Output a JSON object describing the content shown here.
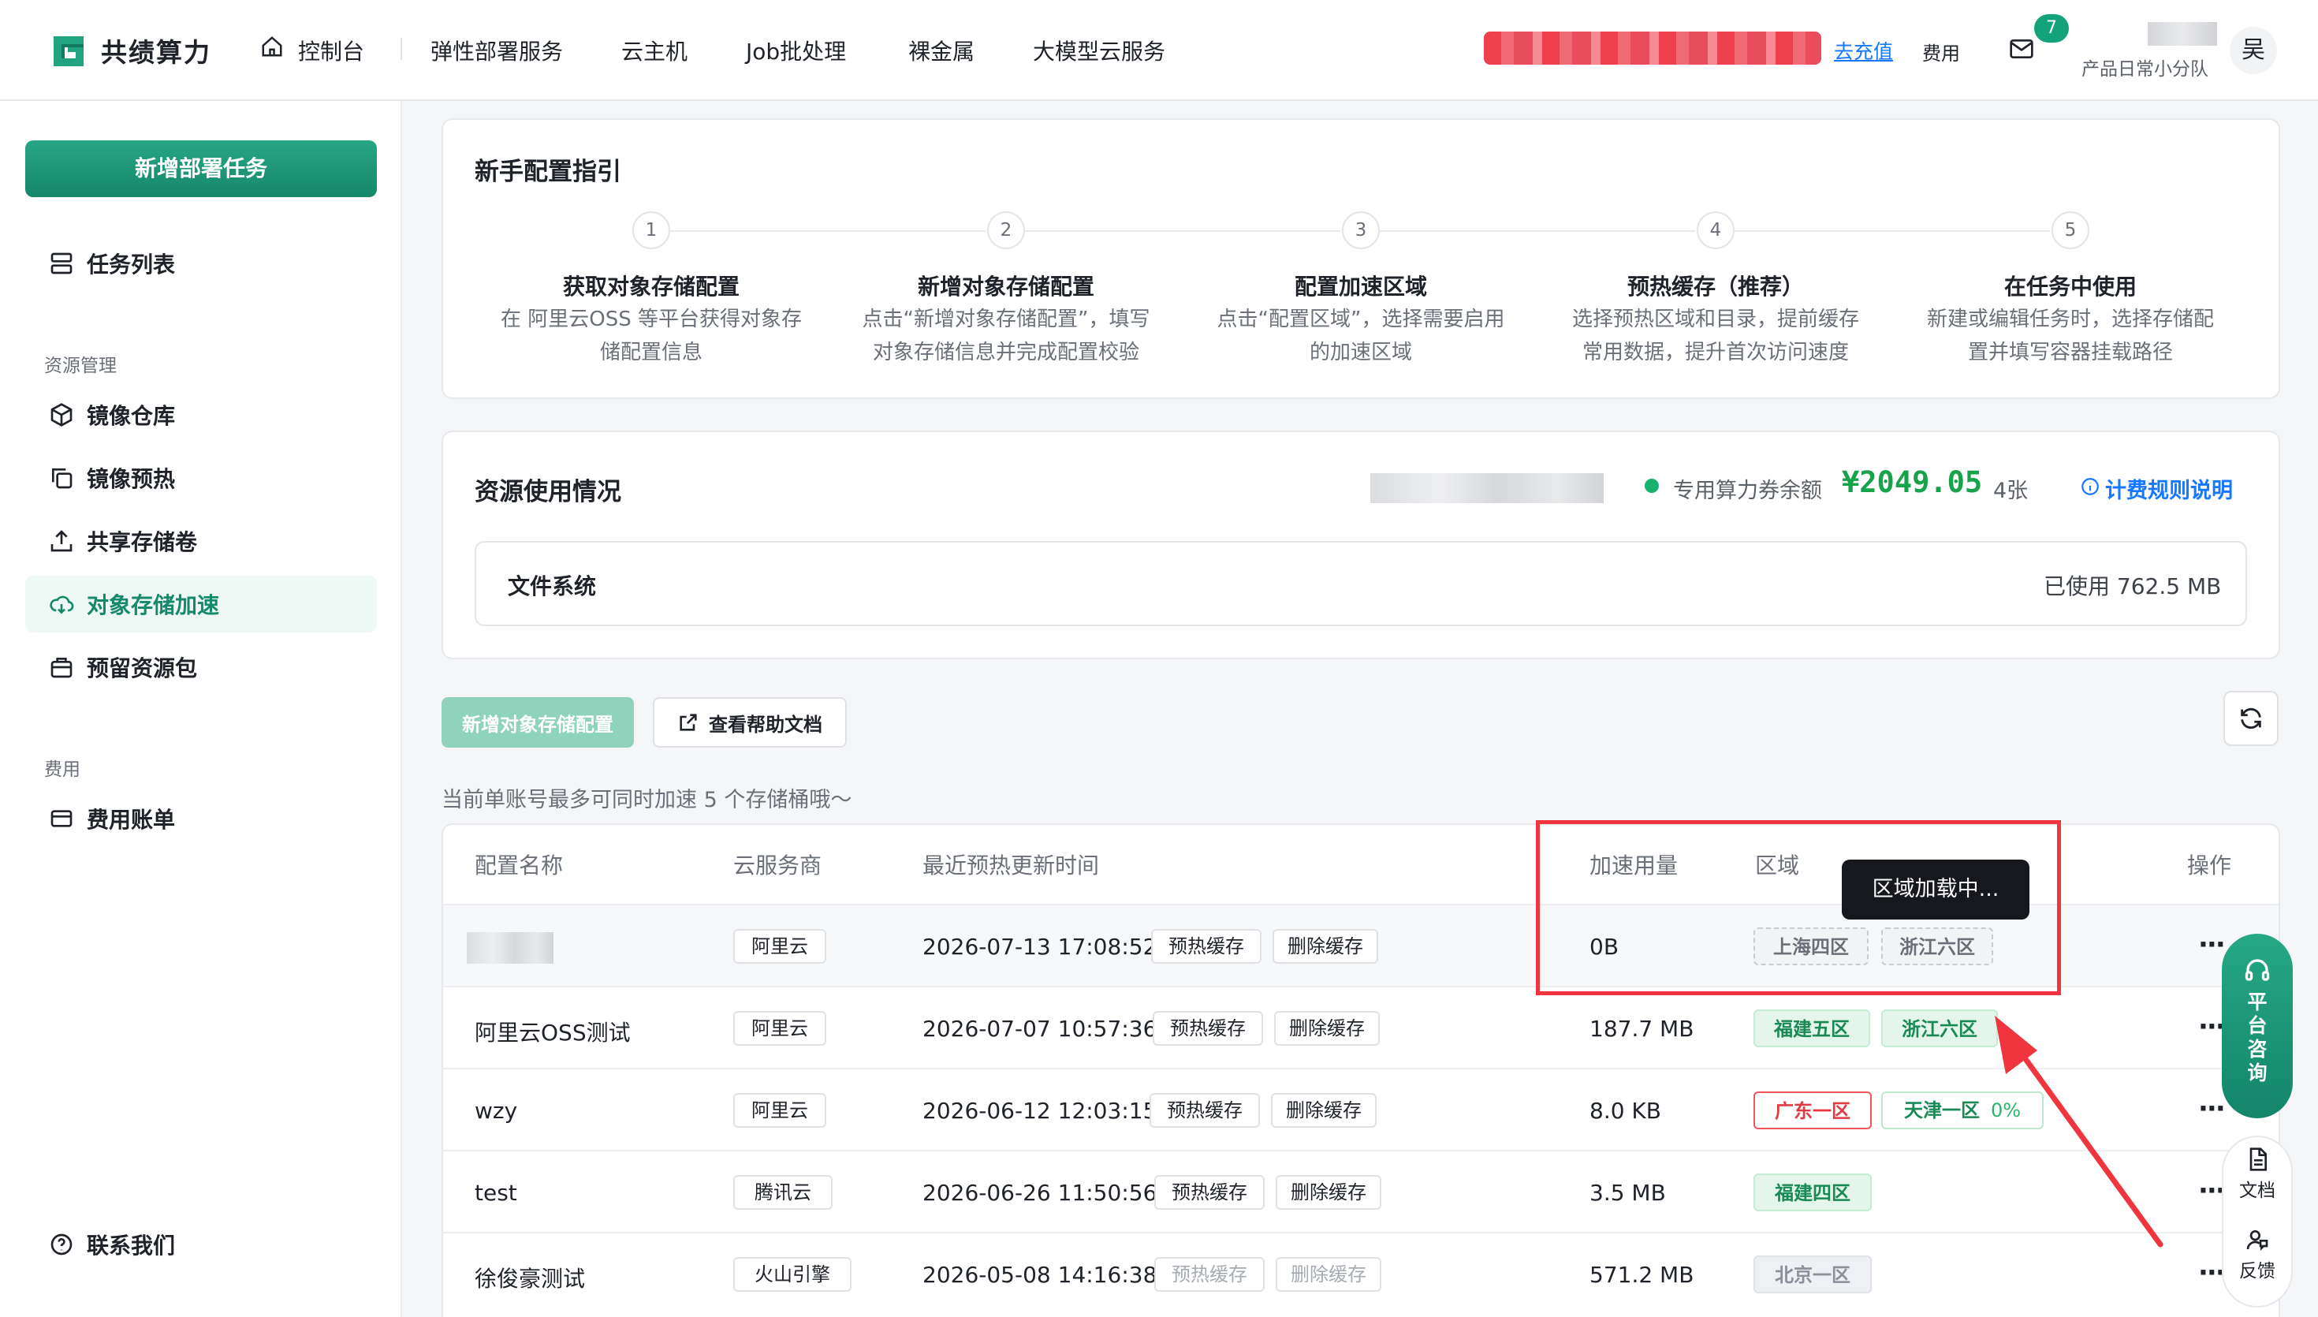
{
  "header": {
    "brand": "共绩算力",
    "nav": [
      "控制台",
      "弹性部署服务",
      "云主机",
      "Job批处理",
      "裸金属",
      "大模型云服务"
    ],
    "recharge": "去充值",
    "fee": "费用",
    "mail_badge": "7",
    "team": "产品日常小分队",
    "avatar": "吴"
  },
  "sidebar": {
    "new_task": "新增部署任务",
    "task_list": "任务列表",
    "section_resource": "资源管理",
    "items": [
      "镜像仓库",
      "镜像预热",
      "共享存储卷",
      "对象存储加速",
      "预留资源包"
    ],
    "section_fee": "费用",
    "fee_item": "费用账单",
    "contact": "联系我们"
  },
  "guide": {
    "title": "新手配置指引",
    "steps": [
      {
        "num": "1",
        "title": "获取对象存储配置",
        "desc1": "在 阿里云OSS 等平台获得对象存",
        "desc2": "储配置信息"
      },
      {
        "num": "2",
        "title": "新增对象存储配置",
        "desc1": "点击“新增对象存储配置”，填写",
        "desc2": "对象存储信息并完成配置校验"
      },
      {
        "num": "3",
        "title": "配置加速区域",
        "desc1": "点击“配置区域”，选择需要启用",
        "desc2": "的加速区域"
      },
      {
        "num": "4",
        "title": "预热缓存（推荐）",
        "desc1": "选择预热区域和目录，提前缓存",
        "desc2": "常用数据，提升首次访问速度"
      },
      {
        "num": "5",
        "title": "在任务中使用",
        "desc1": "新建或编辑任务时，选择存储配",
        "desc2": "置并填写容器挂载路径"
      }
    ]
  },
  "usage": {
    "title": "资源使用情况",
    "balance_label": "专用算力券余额",
    "balance": "¥2049.05",
    "count": "4张",
    "billing_link": "计费规则说明",
    "fs_label": "文件系统",
    "fs_used": "已使用 762.5 MB"
  },
  "actions": {
    "add_config": "新增对象存储配置",
    "help_doc": "查看帮助文档",
    "notice": "当前单账号最多可同时加速 5 个存储桶哦～"
  },
  "table": {
    "headers": [
      "配置名称",
      "云服务商",
      "最近预热更新时间",
      "加速用量",
      "区域",
      "操作"
    ],
    "prewarm": "预热缓存",
    "delete_cache": "删除缓存",
    "tooltip": "区域加载中...",
    "rows": [
      {
        "name": "",
        "vendor": "阿里云",
        "time": "2026-07-13 17:08:52",
        "usage": "0B",
        "regions": [
          "上海四区",
          "浙江六区"
        ]
      },
      {
        "name": "阿里云OSS测试",
        "vendor": "阿里云",
        "time": "2026-07-07 10:57:36",
        "usage": "187.7 MB",
        "regions": [
          "福建五区",
          "浙江六区"
        ]
      },
      {
        "name": "wzy",
        "vendor": "阿里云",
        "time": "2026-06-12 12:03:15",
        "usage": "8.0 KB",
        "regions": [
          "广东一区",
          "天津一区"
        ],
        "progress": "0%"
      },
      {
        "name": "test",
        "vendor": "腾讯云",
        "time": "2026-06-26 11:50:56",
        "usage": "3.5 MB",
        "regions": [
          "福建四区"
        ]
      },
      {
        "name": "徐俊豪测试",
        "vendor": "火山引擎",
        "time": "2026-05-08 14:16:38",
        "usage": "571.2 MB",
        "regions": [
          "北京一区"
        ]
      }
    ]
  },
  "float": {
    "consult": [
      "平",
      "台",
      "咨",
      "询"
    ],
    "docs": "文档",
    "feedback": "反馈"
  },
  "colors": {
    "brand": "#17876a",
    "accent_link": "#1677ff",
    "highlight": "#f0353f",
    "balance": "#16a34a"
  }
}
